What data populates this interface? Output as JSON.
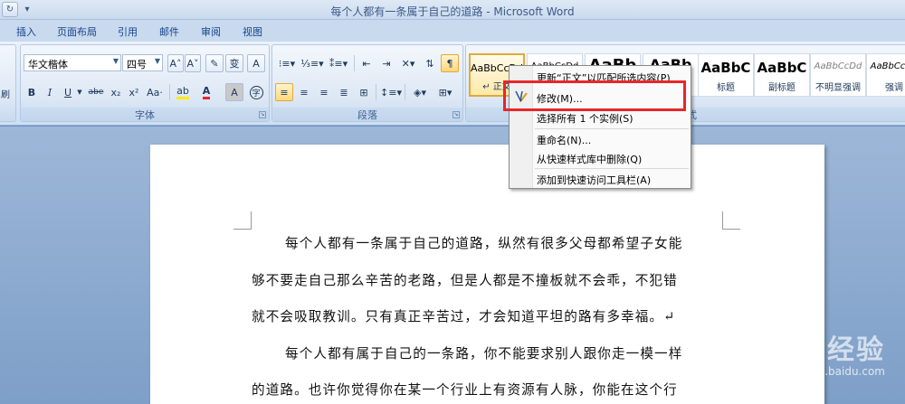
{
  "window": {
    "title": "每个人都有一条属于自己的道路 - Microsoft Word"
  },
  "tabs": [
    "插入",
    "页面布局",
    "引用",
    "邮件",
    "审阅",
    "视图"
  ],
  "font_group": {
    "font_name": "华文楷体",
    "font_size": "四号",
    "label": "字体",
    "buttons": {
      "grow": "A˄",
      "shrink": "A˅",
      "bold": "B",
      "italic": "I",
      "underline": "U",
      "strike": "abe",
      "subscript": "x₂",
      "superscript": "x²",
      "change_case": "Aa·",
      "font_color": "A",
      "char_shade": "A",
      "enclose": "字",
      "pinyin": "变"
    }
  },
  "paragraph_group": {
    "label": "段落"
  },
  "styles_group": {
    "label": "样式",
    "tiles": [
      {
        "sample": "AaBbCcDd",
        "name": "↵ 正文",
        "selected": true
      },
      {
        "sample": "AaBbCcDd",
        "name": ""
      },
      {
        "sample": "AaBb",
        "name": ""
      },
      {
        "sample": "AaBb",
        "name": ""
      },
      {
        "sample": "AaBbC",
        "name": "标题"
      },
      {
        "sample": "AaBbC",
        "name": "副标题"
      },
      {
        "sample": "AaBbCcDd",
        "name": "不明显强调"
      },
      {
        "sample": "AaBbCcDd",
        "name": "强调"
      }
    ]
  },
  "context_menu": {
    "items": [
      {
        "label": "更新“正文”以匹配所选内容(P)"
      },
      {
        "label": "修改(M)..."
      },
      {
        "label": "选择所有 1 个实例(S)"
      },
      {
        "label": "重命名(N)..."
      },
      {
        "label": "从快速样式库中删除(Q)"
      },
      {
        "label": "添加到快速访问工具栏(A)"
      }
    ]
  },
  "document": {
    "lines": [
      "每个人都有一条属于自己的道路，纵然有很多父母都希望子女能",
      "够不要走自己那么辛苦的老路，但是人都是不撞板就不会乖，不犯错",
      "就不会吸取教训。只有真正辛苦过，才会知道平坦的路有多幸福。↵",
      "每个人都有属于自己的一条路，你不能要求别人跟你走一模一样",
      "的道路。也许你觉得你在某一个行业上有资源有人脉，你能在这个行"
    ]
  },
  "watermark": {
    "main": "Baidu经验",
    "sub": "jingyan.baidu.com"
  },
  "colors": {
    "highlight_box": "#e8262a",
    "selected_style": "#e3a93a",
    "ribbon": "#dbe7f5"
  }
}
